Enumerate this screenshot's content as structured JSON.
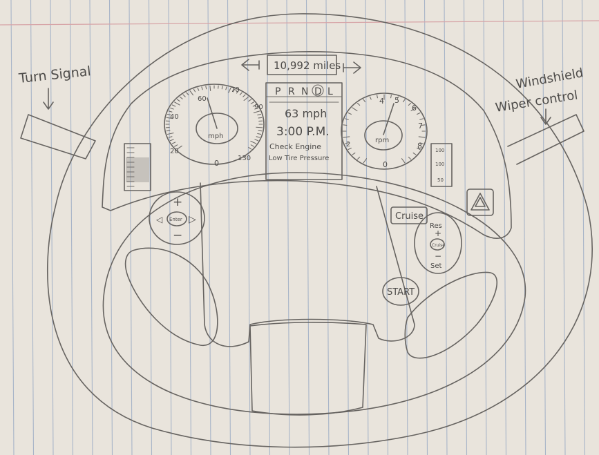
{
  "labels": {
    "turn_signal": "Turn Signal",
    "windshield_line1": "Windshield",
    "windshield_line2": "Wiper control"
  },
  "odometer": {
    "value": "10,992 miles"
  },
  "gear_indicator": {
    "gears": [
      "P",
      "R",
      "N",
      "D",
      "L"
    ],
    "selected": "D"
  },
  "center_display": {
    "speed": "63 mph",
    "time": "3:00 P.M.",
    "warning_1": "Check Engine",
    "warning_2": "Low Tire Pressure"
  },
  "speedometer": {
    "unit_label": "mph",
    "tick_labels": [
      "20",
      "40",
      "60",
      "70",
      "90",
      "130",
      "0"
    ]
  },
  "tachometer": {
    "unit_label": "rpm",
    "tick_labels": [
      "2",
      "4",
      "5",
      "6",
      "7",
      "8",
      "0"
    ]
  },
  "left_controls": {
    "plus": "+",
    "minus": "−",
    "center": "Enter",
    "left_arrow": "◁",
    "right_arrow": "▷"
  },
  "right_controls": {
    "cruise": "Cruise",
    "res": "Res",
    "plus": "+",
    "minus": "−",
    "set": "Set",
    "center": "Cruise",
    "start": "START"
  },
  "right_gauge": {
    "ticks": [
      "100",
      "100",
      "50"
    ]
  },
  "colors": {
    "paper": "#e9e4dc",
    "rule_line": "#a7b4c8",
    "margin_line": "#d7a4a7",
    "pencil": "#666360"
  }
}
